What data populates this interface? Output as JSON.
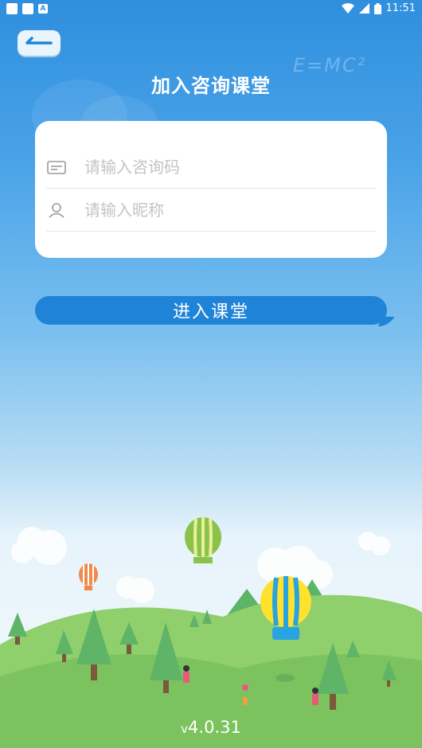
{
  "status_bar": {
    "time": "11:51",
    "battery_label": "B"
  },
  "header": {
    "title": "加入咨询课堂",
    "decor_formula": "E=MC²"
  },
  "form": {
    "code_placeholder": "请输入咨询码",
    "nickname_placeholder": "请输入昵称"
  },
  "actions": {
    "enter_label": "进入课堂"
  },
  "footer": {
    "version_prefix": "v",
    "version_number": "4.0.31"
  },
  "colors": {
    "primary": "#1f84d8",
    "sky_top": "#2f8fde",
    "grass": "#7cc35f"
  },
  "icons": [
    "back-arrow-icon",
    "card-icon",
    "user-icon",
    "wifi-icon",
    "signal-icon",
    "battery-icon"
  ]
}
